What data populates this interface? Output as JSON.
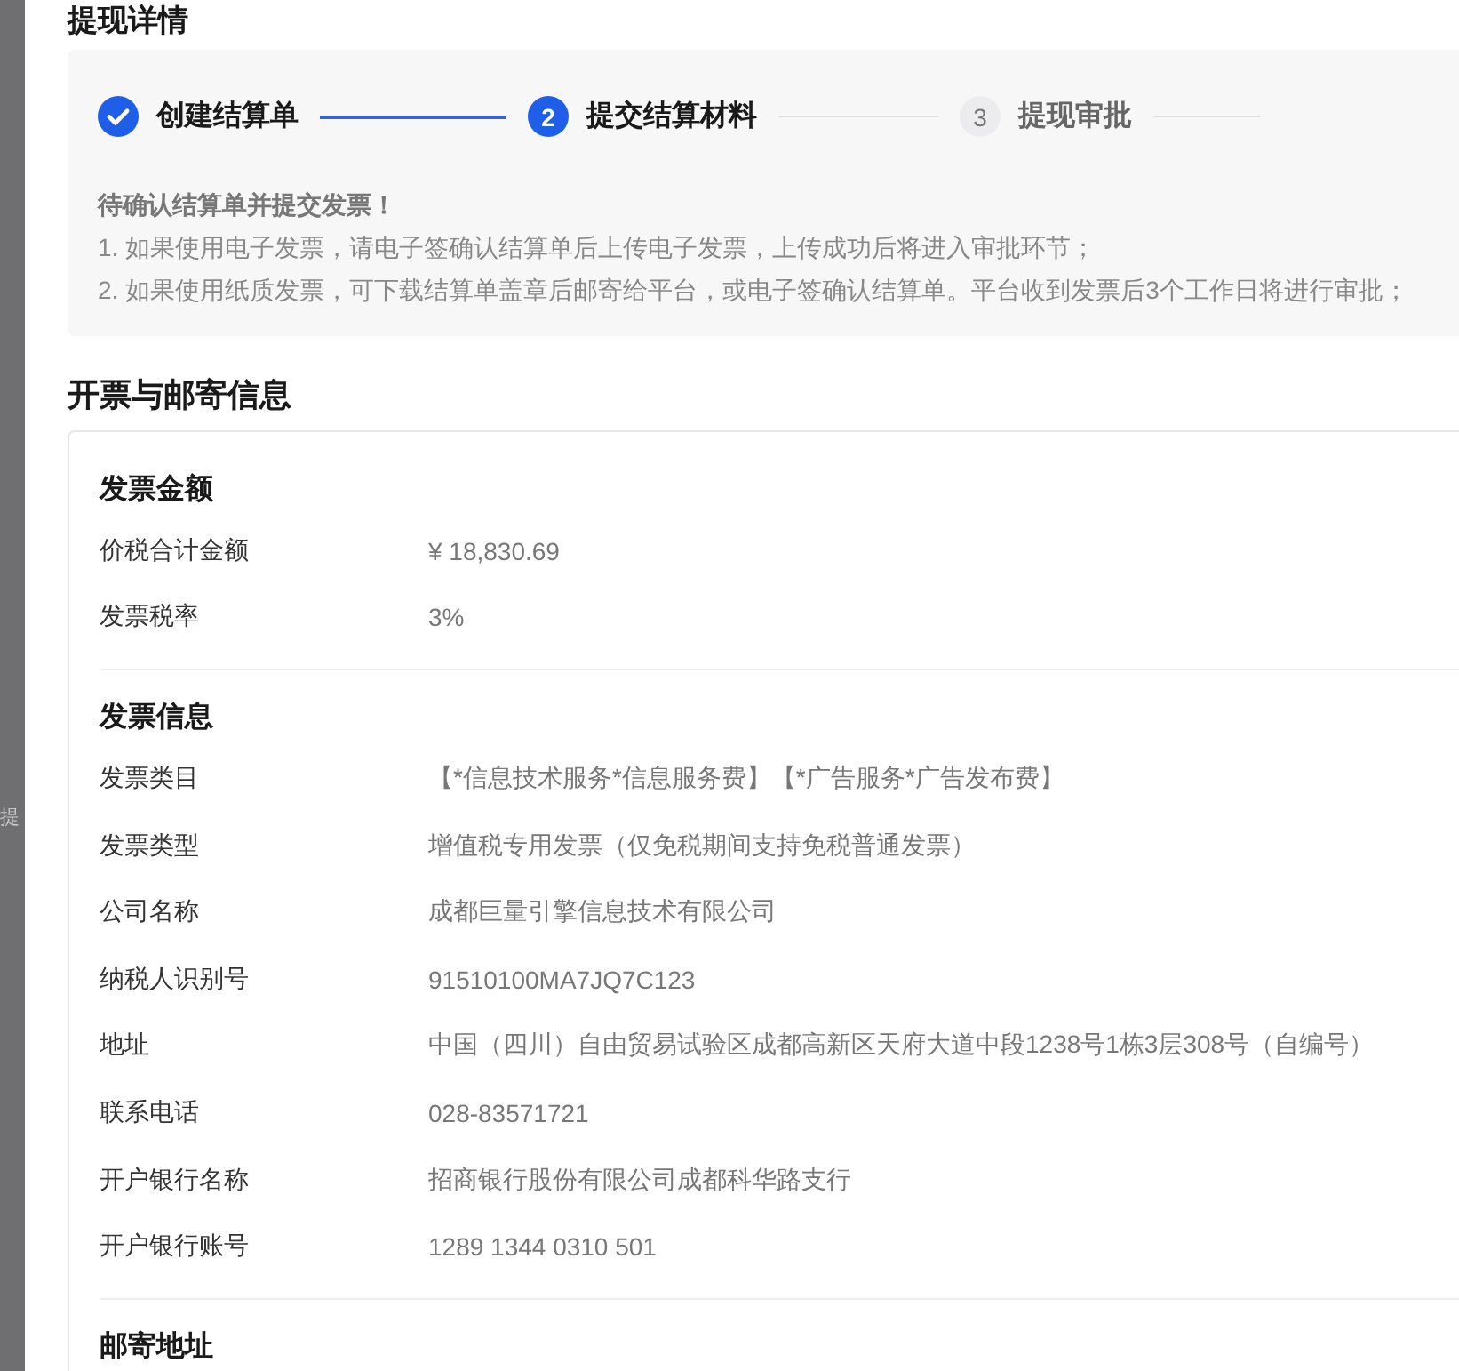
{
  "page_title": "提现详情",
  "side_fragment": "提",
  "steps": [
    {
      "label": "创建结算单",
      "kind": "done"
    },
    {
      "number": "2",
      "label": "提交结算材料",
      "kind": "active"
    },
    {
      "number": "3",
      "label": "提现审批",
      "kind": "waiting"
    }
  ],
  "notice": {
    "title": "待确认结算单并提交发票！",
    "lines": [
      "1. 如果使用电子发票，请电子签确认结算单后上传电子发票，上传成功后将进入审批环节；",
      "2. 如果使用纸质发票，可下载结算单盖章后邮寄给平台，或电子签确认结算单。平台收到发票后3个工作日将进行审批；"
    ]
  },
  "section_title": "开票与邮寄信息",
  "groups": [
    {
      "title": "发票金额",
      "rows": [
        {
          "label": "价税合计金额",
          "value": "¥ 18,830.69"
        },
        {
          "label": "发票税率",
          "value": "3%"
        }
      ]
    },
    {
      "title": "发票信息",
      "rows": [
        {
          "label": "发票类目",
          "value": "【*信息技术服务*信息服务费】【*广告服务*广告发布费】"
        },
        {
          "label": "发票类型",
          "value": "增值税专用发票（仅免税期间支持免税普通发票）"
        },
        {
          "label": "公司名称",
          "value": "成都巨量引擎信息技术有限公司"
        },
        {
          "label": "纳税人识别号",
          "value": "91510100MA7JQ7C123"
        },
        {
          "label": "地址",
          "value": "中国（四川）自由贸易试验区成都高新区天府大道中段1238号1栋3层308号（自编号）"
        },
        {
          "label": "联系电话",
          "value": "028-83571721"
        },
        {
          "label": "开户银行名称",
          "value": "招商银行股份有限公司成都科华路支行"
        },
        {
          "label": "开户银行账号",
          "value": "1289 1344 0310 501"
        }
      ]
    },
    {
      "title": "邮寄地址"
    }
  ]
}
